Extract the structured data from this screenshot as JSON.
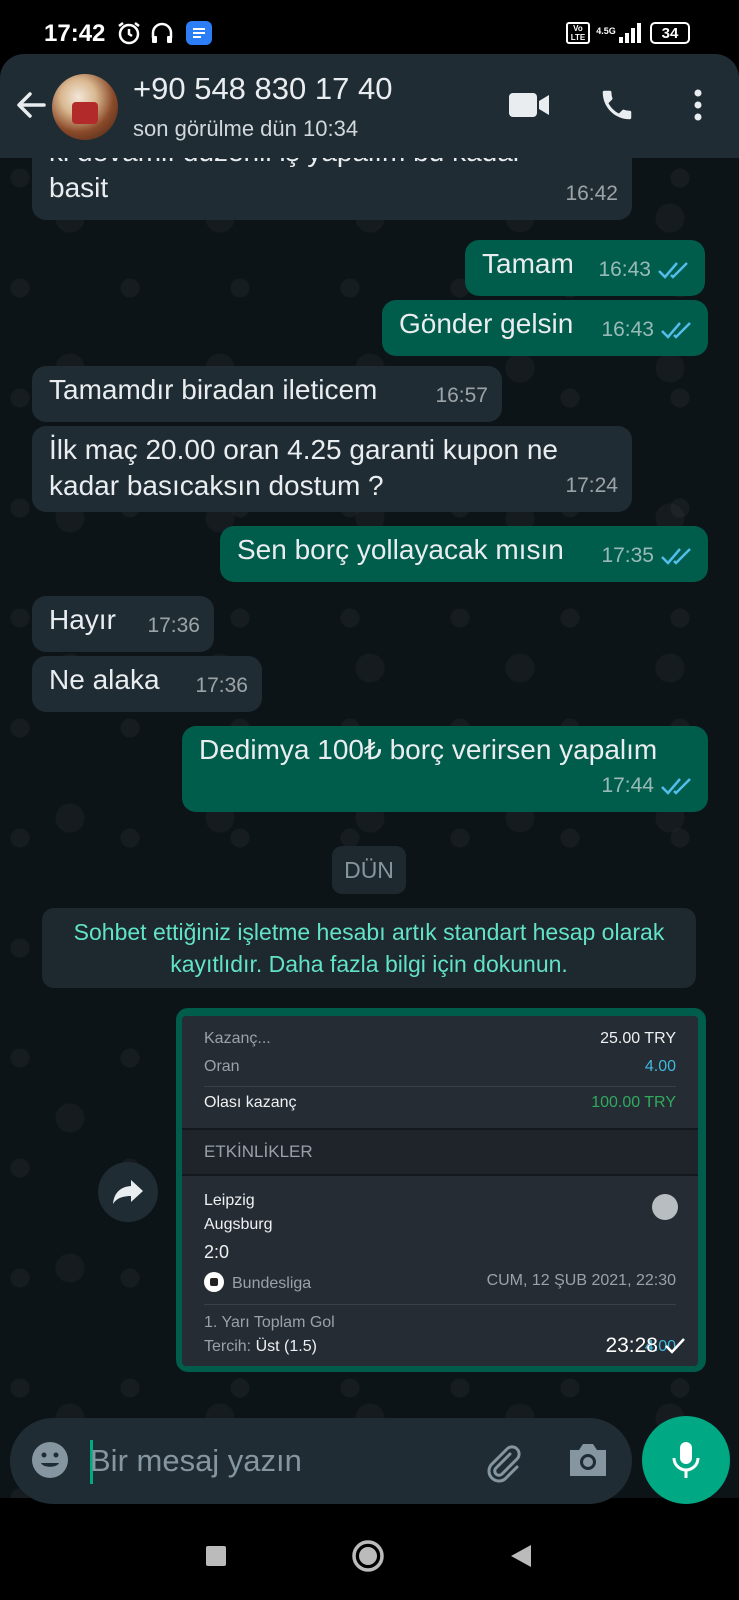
{
  "status_bar": {
    "time": "17:42",
    "network": "4.5G",
    "volte": "Vo LTE",
    "battery": "34"
  },
  "header": {
    "contact_name": "+90 548 830 17 40",
    "contact_status": "son görülme dün 10:34"
  },
  "messages": [
    {
      "dir": "in",
      "text": "ki devamlı düzenli iş yapalım bu kadar\nbasit",
      "time": "16:42"
    },
    {
      "dir": "out",
      "text": "Tamam",
      "time": "16:43",
      "ticks": "read"
    },
    {
      "dir": "out",
      "text": "Gönder gelsin",
      "time": "16:43",
      "ticks": "read"
    },
    {
      "dir": "in",
      "text": "Tamamdır biradan ileticem",
      "time": "16:57"
    },
    {
      "dir": "in",
      "text": "İlk maç 20.00 oran 4.25 garanti kupon ne\nkadar basıcaksın dostum ?",
      "time": "17:24"
    },
    {
      "dir": "out",
      "text": "Sen borç yollayacak mısın",
      "time": "17:35",
      "ticks": "read"
    },
    {
      "dir": "in",
      "text": "Hayır",
      "time": "17:36"
    },
    {
      "dir": "in",
      "text": "Ne alaka",
      "time": "17:36"
    },
    {
      "dir": "out",
      "text": "Dedimya 100₺ borç verirsen yapalım",
      "time": "17:44",
      "ticks": "read"
    }
  ],
  "day_divider": "DÜN",
  "system_note": "Sohbet ettiğiniz işletme hesabı artık standart hesap olarak kayıtlıdır. Daha fazla bilgi için dokunun.",
  "image_message": {
    "time": "23:28",
    "ticks": "sent",
    "ticket": {
      "stake_label": "Kazanç...",
      "stake_value": "25.00 TRY",
      "odds_label": "Oran",
      "odds_value": "4.00",
      "potential_label": "Olası kazanç",
      "potential_value": "100.00 TRY",
      "section_title": "ETKİNLİKLER",
      "home_team": "Leipzig",
      "away_team": "Augsburg",
      "score": "2:0",
      "league": "Bundesliga",
      "datetime": "CUM, 12 ŞUB 2021, 22:30",
      "market": "1. Yarı Toplam Gol",
      "pick_label": "Tercih:",
      "pick_value": "Üst (1.5)",
      "pick_odds": "4.00"
    }
  },
  "composer": {
    "placeholder": "Bir mesaj yazın"
  },
  "colors": {
    "outgoing_bubble": "#005c4b",
    "incoming_bubble": "#202c33",
    "accent": "#00a884",
    "read_ticks": "#53bdeb"
  }
}
